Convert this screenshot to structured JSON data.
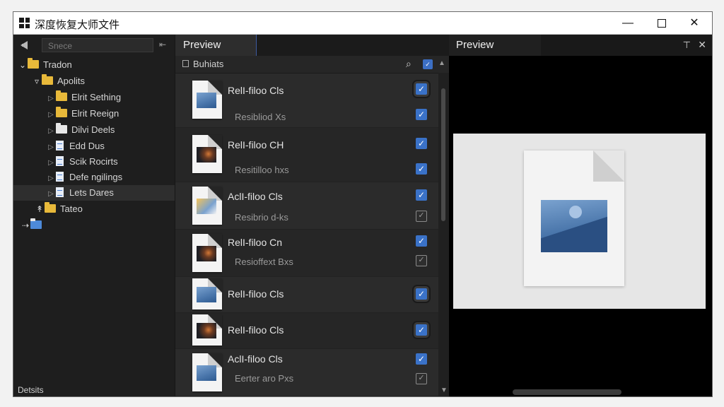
{
  "window": {
    "title": "深度恢复大师文件"
  },
  "left_panel": {
    "search_placeholder": "Snece",
    "tree": [
      {
        "label": "Tradon",
        "icon": "folder-icon",
        "level": 0,
        "expanded": true
      },
      {
        "label": "Apolits",
        "icon": "folder-icon",
        "level": 1,
        "expanded": true
      },
      {
        "label": "Elrit Sething",
        "icon": "folder-icon",
        "level": 2
      },
      {
        "label": "Elrit Reeign",
        "icon": "folder-icon",
        "level": 2
      },
      {
        "label": "Dilvi Deels",
        "icon": "white-folder-icon",
        "level": 2
      },
      {
        "label": "Edd Dus",
        "icon": "document-icon",
        "level": 2
      },
      {
        "label": "Scik Rocirts",
        "icon": "document-icon",
        "level": 2
      },
      {
        "label": "Defe ngilings",
        "icon": "document-icon",
        "level": 2
      },
      {
        "label": "Lets Dares",
        "icon": "document-icon",
        "level": 2,
        "selected": true
      },
      {
        "label": "Tateo",
        "icon": "folder-icon",
        "level": 1
      }
    ],
    "details_label": "Detsits"
  },
  "middle_panel": {
    "tab_label": "Preview",
    "subheader_label": "Buhiats",
    "files": [
      {
        "name": "RelI-filoo Cls",
        "sub": "Resibliod Xs",
        "checks": [
          true,
          true
        ]
      },
      {
        "name": "RelI-filoo CH",
        "sub": "Resitilloo hxs",
        "checks": [
          true,
          true
        ]
      },
      {
        "name": "AclI-filoo Cls",
        "sub": "Resibrio d-ks",
        "checks": [
          true,
          false
        ]
      },
      {
        "name": "RelI-filoo Cn",
        "sub": "Resioffext Bxs",
        "checks": [
          true,
          false
        ]
      },
      {
        "name": "RelI-filoo Cls",
        "sub": "",
        "checks": [
          true
        ]
      },
      {
        "name": "RelI-filoo Cls",
        "sub": "",
        "checks": [
          true
        ]
      },
      {
        "name": "AclI-filoo Cls",
        "sub": "Eerter aro Pxs",
        "checks": [
          true,
          false
        ]
      }
    ]
  },
  "right_panel": {
    "tab_label": "Preview"
  }
}
